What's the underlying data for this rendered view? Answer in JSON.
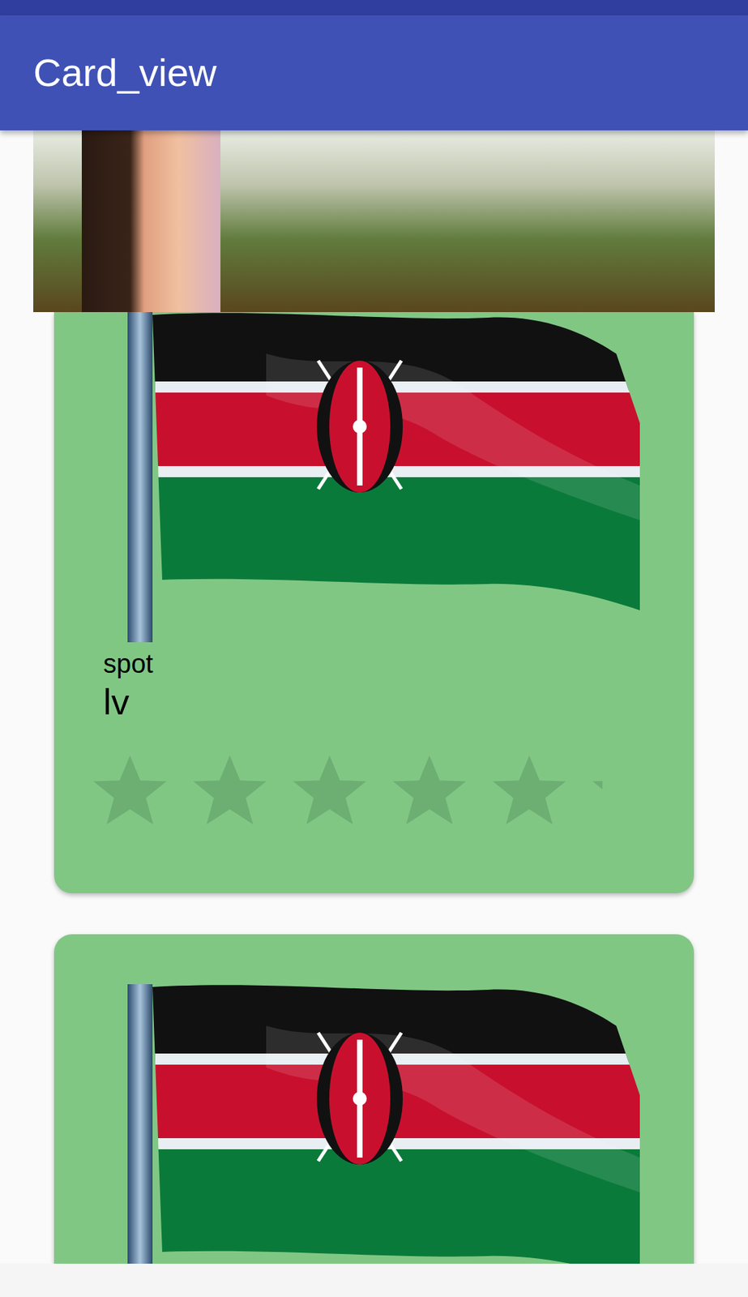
{
  "app_bar": {
    "title": "Card_view"
  },
  "cards": [
    {
      "kind": "full",
      "title": "spot",
      "subtitle": "lv",
      "stars": 0
    },
    {
      "kind": "clipped"
    }
  ]
}
